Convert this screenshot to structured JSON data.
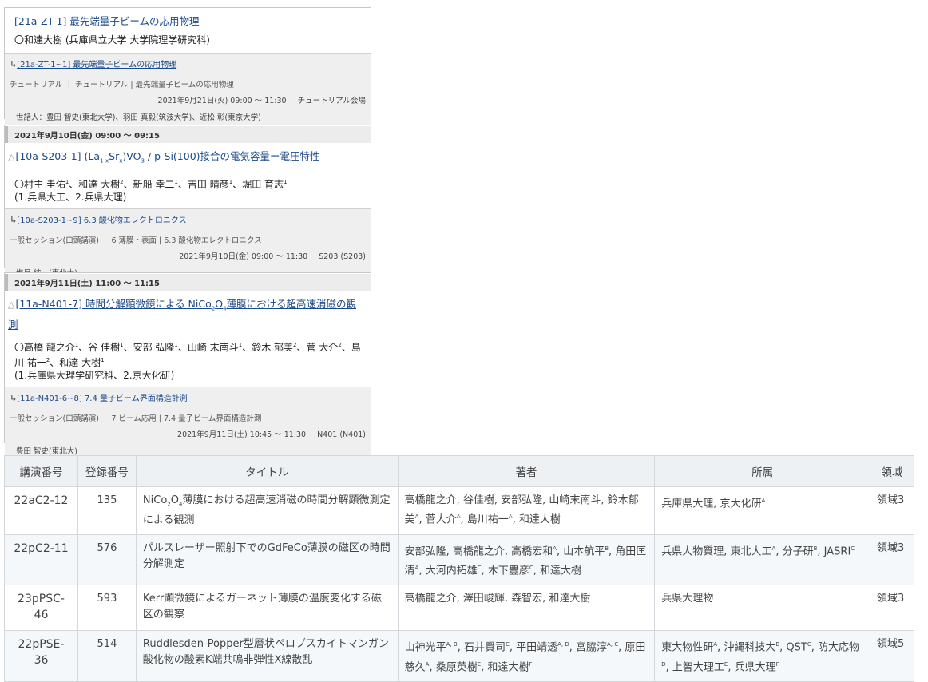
{
  "card1": {
    "title": "[21a-ZT-1] 最先端量子ビームの応用物理",
    "authors": "〇和達大樹 (兵庫県立大学 大学院理学研究科)",
    "session_link": "[21a-ZT-1~1] 最先端量子ビームの応用物理",
    "category": "チュートリアル ｜ チュートリアル | 最先端量子ビームの応用物理",
    "time": "2021年9月21日(火) 09:00 〜 11:30",
    "room": "チュートリアル会場",
    "person": "世話人：豊田 智史(東北大学)、羽田 真毅(筑波大学)、近松 彰(東京大学)"
  },
  "card2": {
    "date": "2021年9月10日(金) 09:00 〜 09:15",
    "title_pre": "[10a-S203-1] (La",
    "title_post": "接合の電気容量ー電圧特性",
    "authors_line1": "〇村主 圭佑1、和達 大樹2、新船 幸二1、吉田 晴彦1、堀田 育志1",
    "affil": "(1.兵県大工、2.兵県大理)",
    "session_link": "[10a-S203-1~9] 6.3 酸化物エレクトロニクス",
    "category": "一般セッション(口頭講演) ｜ 6 薄膜・表面 | 6.3 酸化物エレクトロニクス",
    "time": "2021年9月10日(金) 09:00 〜 11:30",
    "room": "S203 (S203)",
    "person": "塩貝 純一(東北大)"
  },
  "card3": {
    "date": "2021年9月11日(土) 11:00 〜 11:15",
    "title": "[11a-N401-7] 時間分解顕微鏡による NiCo2O4薄膜における超高速消磁の観測",
    "authors": "〇高橋 龍之介1、谷 佳樹1、安部 弘隆1、山崎 末南斗1、鈴木 郁美2、菅 大介2、島川 祐一2、和達 大樹1",
    "affil": "(1.兵庫県大理学研究科、2.京大化研)",
    "session_link": "[11a-N401-6~8] 7.4 量子ビーム界面構造計測",
    "category": "一般セッション(口頭講演) ｜ 7 ビーム応用 | 7.4 量子ビーム界面構造計測",
    "time": "2021年9月11日(土) 10:45 〜 11:30",
    "room": "N401 (N401)",
    "person": "豊田 智史(東北大)"
  },
  "table": {
    "headers": [
      "講演番号",
      "登録番号",
      "タイトル",
      "著者",
      "所属",
      "領域"
    ],
    "rows": [
      {
        "code": "22aC2-12",
        "num": "135",
        "field": "領域3"
      },
      {
        "code": "22pC2-11",
        "num": "576",
        "title": "パルスレーザー照射下でのGdFeCo薄膜の磁区の時間分解測定",
        "field": "領域3"
      },
      {
        "code": "23pPSC-46",
        "num": "593",
        "title": "Kerr顕微鏡によるガーネット薄膜の温度変化する磁区の観察",
        "authors": "高橋龍之介, 澤田峻輝, 森智宏, 和達大樹",
        "affil": "兵県大理物",
        "field": "領域3"
      },
      {
        "code": "22pPSE-36",
        "num": "514",
        "title": "Ruddlesden-Popper型層状ペロブスカイトマンガン酸化物の酸素K端共鳴非弾性X線散乱",
        "field": "領域5"
      }
    ]
  }
}
